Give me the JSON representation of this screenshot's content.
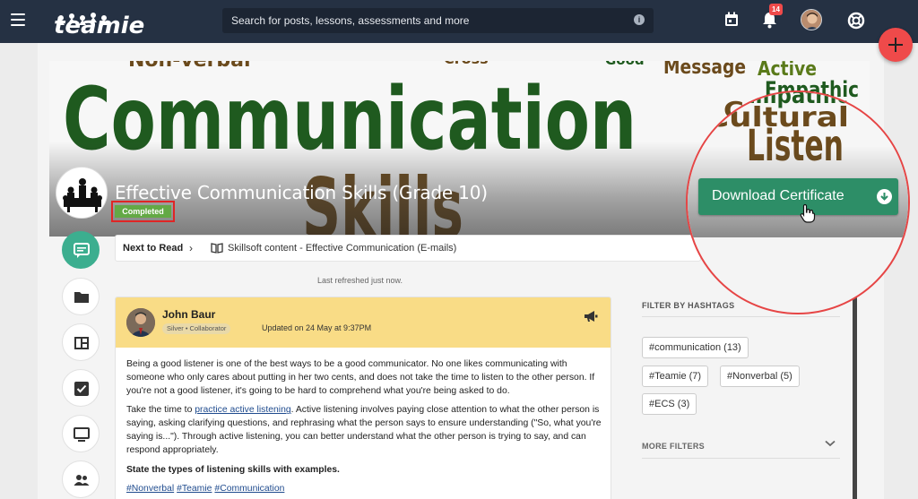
{
  "topbar": {
    "logo_text": "teamie",
    "search_placeholder": "Search for posts, lessons, assessments and more",
    "notifications_count": "14",
    "icons": [
      "menu-icon",
      "info-icon",
      "calendar-icon",
      "bell-icon",
      "avatar",
      "help-lifebuoy-icon"
    ]
  },
  "fab": {
    "icon": "plus-icon"
  },
  "banner": {
    "words": [
      "Communication",
      "Skills",
      "Message",
      "Active",
      "Empathic",
      "Listen",
      "Cultural",
      "Non-verbal",
      "Cross",
      "Good"
    ]
  },
  "course": {
    "title": "Effective Communication Skills (Grade 10)",
    "status": "Completed"
  },
  "download_button": {
    "label": "Download Certificate"
  },
  "sidebar": {
    "items": [
      {
        "name": "newsfeed",
        "icon": "message-icon"
      },
      {
        "name": "materials",
        "icon": "folder-icon"
      },
      {
        "name": "dashboard",
        "icon": "dashboard-icon"
      },
      {
        "name": "assessments",
        "icon": "checkbox-icon"
      },
      {
        "name": "classroom",
        "icon": "monitor-icon"
      },
      {
        "name": "members",
        "icon": "people-icon"
      }
    ]
  },
  "next_to_read": {
    "label": "Next to Read",
    "item": "Skillsoft content - Effective Communication (E-mails)"
  },
  "refreshed": "Last refreshed just now.",
  "post": {
    "author": "John Baur",
    "badge": "Silver • Collaborator",
    "updated": "Updated on 24 May at 9:37PM",
    "paragraph1": "Being a good listener is one of the best ways to be a good communicator. No one likes communicating with someone who only cares about putting in her two cents, and does not take the time to listen to the other person. If you're not a good listener, it's going to be hard to comprehend what you're being asked to do.",
    "p2_before": "Take the time to ",
    "p2_link": "practice active listening",
    "p2_after": ". Active listening involves paying close attention to what the other person is saying, asking clarifying questions, and rephrasing what the person says to ensure understanding (\"So, what you're saying is...\"). Through active listening, you can better understand what the other person is trying to say, and can respond appropriately.",
    "question": "State the types of listening skills with examples.",
    "hashtags": [
      "#Nonverbal",
      "#Teamie",
      "#Communication"
    ]
  },
  "filters": {
    "title": "FILTER BY HASHTAGS",
    "chips": [
      "#communication (13)",
      "#Teamie (7)",
      "#Nonverbal (5)",
      "#ECS (3)"
    ],
    "more": "MORE FILTERS"
  },
  "colors": {
    "topbar": "#253143",
    "accent_green": "#2d8e67",
    "completed_green": "#63a945",
    "highlight_red": "#e64545",
    "post_header": "#f9dc86",
    "word_green": "#1f5a1f",
    "word_brown": "#6b4a1c"
  }
}
